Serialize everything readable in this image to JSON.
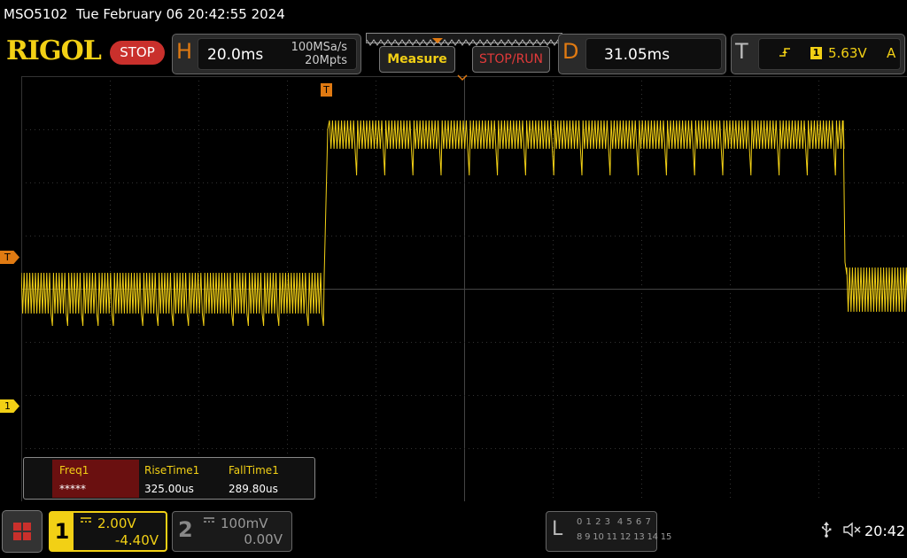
{
  "title_bar": {
    "text": "MSO5102  Tue February 06 20:42:55 2024"
  },
  "brand": {
    "logo": "RIGOL",
    "run_state": "STOP"
  },
  "horizontal": {
    "letter": "H",
    "time_scale": "20.0ms",
    "sample_rate": "100MSa/s",
    "memory_depth": "20Mpts"
  },
  "menus": {
    "measure": "Measure",
    "stop_run": "STOP/RUN"
  },
  "delay": {
    "letter": "D",
    "value": "31.05ms"
  },
  "trigger": {
    "letter": "T",
    "edge_icon": "rising-edge-icon",
    "source": "1",
    "level": "5.63V",
    "mode": "A"
  },
  "markers": {
    "trigger_position": "T",
    "trigger_level": "T",
    "channel1": "1"
  },
  "measurements": {
    "items": [
      {
        "label": "Freq1",
        "value": "*****"
      },
      {
        "label": "RiseTime1",
        "value": "325.00us"
      },
      {
        "label": "FallTime1",
        "value": "289.80us"
      }
    ]
  },
  "channel1": {
    "number": "1",
    "scale": "2.00V",
    "offset": "-4.40V",
    "color": "#f2d015"
  },
  "channel2": {
    "number": "2",
    "scale": "100mV",
    "offset": "0.00V",
    "color": "#888888"
  },
  "logic_analyzer": {
    "letter": "L",
    "row1": "0 1 2 3  4 5 6 7",
    "row2": "8 9 10 11 12 13 14 15"
  },
  "status": {
    "usb_icon": "usb-icon",
    "sound_icon": "speaker-muted-icon",
    "clock": "20:42"
  },
  "colors": {
    "accent_orange": "#e07a12",
    "trace_yellow": "#f2d015",
    "stop_red": "#c9302c"
  }
}
